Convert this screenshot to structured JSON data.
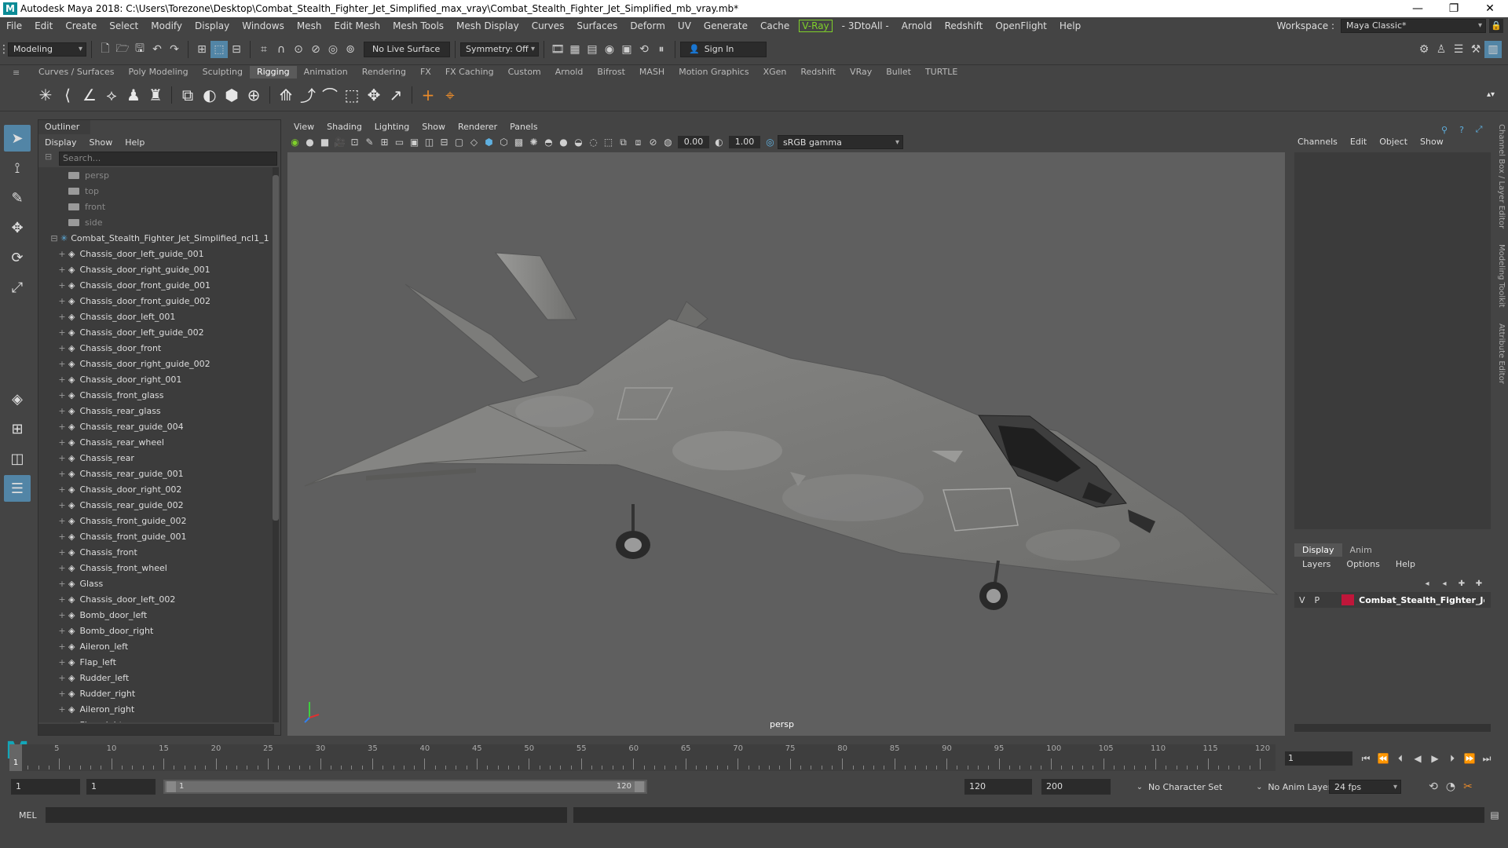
{
  "titlebar": {
    "logo": "M",
    "title": "Autodesk Maya 2018: C:\\Users\\Torezone\\Desktop\\Combat_Stealth_Fighter_Jet_Simplified_max_vray\\Combat_Stealth_Fighter_Jet_Simplified_mb_vray.mb*",
    "min": "—",
    "max": "❐",
    "close": "✕"
  },
  "menubar": {
    "items": [
      "File",
      "Edit",
      "Create",
      "Select",
      "Modify",
      "Display",
      "Windows",
      "Mesh",
      "Edit Mesh",
      "Mesh Tools",
      "Mesh Display",
      "Curves",
      "Surfaces",
      "Deform",
      "UV",
      "Generate",
      "Cache"
    ],
    "vray": "V-Ray",
    "items2": [
      "- 3DtoAll -",
      "Arnold",
      "Redshift",
      "OpenFlight",
      "Help"
    ],
    "workspace_label": "Workspace :",
    "workspace_value": "Maya Classic*"
  },
  "statusline": {
    "mode": "Modeling",
    "live_surface": "No Live Surface",
    "symmetry": "Symmetry: Off",
    "sign_in": "Sign In"
  },
  "shelf": {
    "tabs": [
      "Curves / Surfaces",
      "Poly Modeling",
      "Sculpting",
      "Rigging",
      "Animation",
      "Rendering",
      "FX",
      "FX Caching",
      "Custom",
      "Arnold",
      "Bifrost",
      "MASH",
      "Motion Graphics",
      "XGen",
      "Redshift",
      "VRay",
      "Bullet",
      "TURTLE"
    ],
    "active": "Rigging"
  },
  "outliner": {
    "tab": "Outliner",
    "menu": [
      "Display",
      "Show",
      "Help"
    ],
    "search_placeholder": "Search...",
    "cameras": [
      "persp",
      "top",
      "front",
      "side"
    ],
    "group": "Combat_Stealth_Fighter_Jet_Simplified_ncl1_1",
    "items": [
      "Chassis_door_left_guide_001",
      "Chassis_door_right_guide_001",
      "Chassis_door_front_guide_001",
      "Chassis_door_front_guide_002",
      "Chassis_door_left_001",
      "Chassis_door_left_guide_002",
      "Chassis_door_front",
      "Chassis_door_right_guide_002",
      "Chassis_door_right_001",
      "Chassis_front_glass",
      "Chassis_rear_glass",
      "Chassis_rear_guide_004",
      "Chassis_rear_wheel",
      "Chassis_rear",
      "Chassis_rear_guide_001",
      "Chassis_door_right_002",
      "Chassis_rear_guide_002",
      "Chassis_front_guide_002",
      "Chassis_front_guide_001",
      "Chassis_front",
      "Chassis_front_wheel",
      "Glass",
      "Chassis_door_left_002",
      "Bomb_door_left",
      "Bomb_door_right",
      "Aileron_left",
      "Flap_left",
      "Rudder_left",
      "Rudder_right",
      "Aileron_right",
      "Flap_right"
    ]
  },
  "viewport": {
    "menu": [
      "View",
      "Shading",
      "Lighting",
      "Show",
      "Renderer",
      "Panels"
    ],
    "exposure": "0.00",
    "gamma": "1.00",
    "colorspace": "sRGB gamma",
    "camera_label": "persp"
  },
  "channelbox": {
    "menu": [
      "Channels",
      "Edit",
      "Object",
      "Show"
    ],
    "layer_tabs": [
      "Display",
      "Anim"
    ],
    "layer_menu": [
      "Layers",
      "Options",
      "Help"
    ],
    "layer_v": "V",
    "layer_p": "P",
    "layer_name": "Combat_Stealth_Fighter_Jet_Si",
    "layer_color": "#c0163a"
  },
  "sidebar_tabs": [
    "Channel Box / Layer Editor",
    "Modeling Toolkit",
    "Attribute Editor"
  ],
  "timeslider": {
    "ticks": [
      "5",
      "10",
      "15",
      "20",
      "25",
      "30",
      "35",
      "40",
      "45",
      "50",
      "55",
      "60",
      "65",
      "70",
      "75",
      "80",
      "85",
      "90",
      "95",
      "100",
      "105",
      "110",
      "115",
      "120"
    ],
    "current": "1",
    "current_frame_field": "1"
  },
  "range": {
    "start": "1",
    "playback_start": "1",
    "slider_start": "1",
    "slider_end": "120",
    "playback_end": "120",
    "end": "200",
    "character_set": "No Character Set",
    "anim_layer": "No Anim Layer",
    "fps": "24 fps"
  },
  "mel": {
    "label": "MEL"
  }
}
